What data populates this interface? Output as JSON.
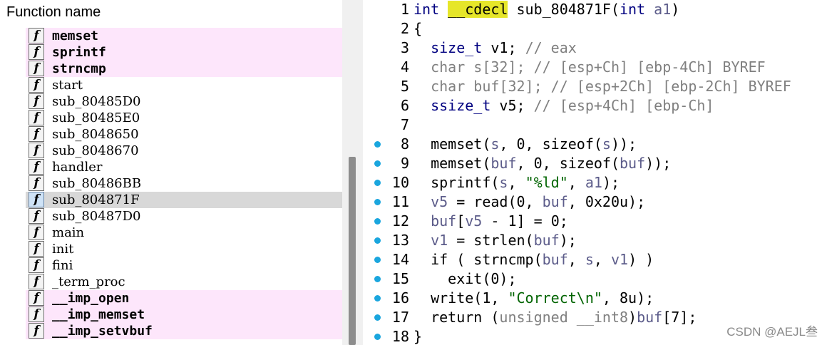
{
  "function_list": {
    "header": "Function name",
    "icon_glyph": "f",
    "items": [
      {
        "name": "memset",
        "imported": true
      },
      {
        "name": "sprintf",
        "imported": true
      },
      {
        "name": "strncmp",
        "imported": true
      },
      {
        "name": "start"
      },
      {
        "name": "sub_80485D0"
      },
      {
        "name": "sub_80485E0"
      },
      {
        "name": "sub_8048650"
      },
      {
        "name": "sub_8048670"
      },
      {
        "name": "handler"
      },
      {
        "name": "sub_80486BB"
      },
      {
        "name": "sub_804871F",
        "selected": true
      },
      {
        "name": "sub_80487D0"
      },
      {
        "name": "main"
      },
      {
        "name": "init"
      },
      {
        "name": "fini"
      },
      {
        "name": "_term_proc"
      },
      {
        "name": "__imp_open",
        "imported": true
      },
      {
        "name": "__imp_memset",
        "imported": true
      },
      {
        "name": "__imp_setvbuf",
        "imported": true
      }
    ]
  },
  "code": {
    "lines": [
      {
        "n": "1",
        "bp": false,
        "tokens": [
          [
            "kw",
            "int"
          ],
          [
            "id",
            " "
          ],
          [
            "hl",
            "__cdecl"
          ],
          [
            "id",
            " sub_804871F("
          ],
          [
            "kw",
            "int"
          ],
          [
            "var",
            " a1"
          ],
          [
            "id",
            ")"
          ]
        ]
      },
      {
        "n": "2",
        "bp": false,
        "tokens": [
          [
            "id",
            "{"
          ]
        ]
      },
      {
        "n": "3",
        "bp": false,
        "tokens": [
          [
            "id",
            "  "
          ],
          [
            "kw",
            "size_t"
          ],
          [
            "id",
            " v1; "
          ],
          [
            "cmt",
            "// eax"
          ]
        ]
      },
      {
        "n": "4",
        "bp": false,
        "tokens": [
          [
            "dim",
            "  char s[32]; "
          ],
          [
            "cmt",
            "// [esp+Ch] [ebp-4Ch] BYREF"
          ]
        ]
      },
      {
        "n": "5",
        "bp": false,
        "tokens": [
          [
            "dim",
            "  char buf[32]; "
          ],
          [
            "cmt",
            "// [esp+2Ch] [ebp-2Ch] BYREF"
          ]
        ]
      },
      {
        "n": "6",
        "bp": false,
        "tokens": [
          [
            "id",
            "  "
          ],
          [
            "kw",
            "ssize_t"
          ],
          [
            "id",
            " v5; "
          ],
          [
            "cmt",
            "// [esp+4Ch] [ebp-Ch]"
          ]
        ]
      },
      {
        "n": "7",
        "bp": false,
        "tokens": []
      },
      {
        "n": "8",
        "bp": true,
        "tokens": [
          [
            "id",
            "  memset("
          ],
          [
            "var",
            "s"
          ],
          [
            "id",
            ", 0, sizeof("
          ],
          [
            "var",
            "s"
          ],
          [
            "id",
            "));"
          ]
        ]
      },
      {
        "n": "9",
        "bp": true,
        "tokens": [
          [
            "id",
            "  memset("
          ],
          [
            "var",
            "buf"
          ],
          [
            "id",
            ", 0, sizeof("
          ],
          [
            "var",
            "buf"
          ],
          [
            "id",
            "));"
          ]
        ]
      },
      {
        "n": "10",
        "bp": true,
        "tokens": [
          [
            "id",
            "  sprintf("
          ],
          [
            "var",
            "s"
          ],
          [
            "id",
            ", "
          ],
          [
            "str",
            "\"%ld\""
          ],
          [
            "id",
            ", "
          ],
          [
            "var",
            "a1"
          ],
          [
            "id",
            ");"
          ]
        ]
      },
      {
        "n": "11",
        "bp": true,
        "tokens": [
          [
            "id",
            "  "
          ],
          [
            "var",
            "v5"
          ],
          [
            "id",
            " = read(0, "
          ],
          [
            "var",
            "buf"
          ],
          [
            "id",
            ", 0x20u);"
          ]
        ]
      },
      {
        "n": "12",
        "bp": true,
        "tokens": [
          [
            "id",
            "  "
          ],
          [
            "var",
            "buf"
          ],
          [
            "id",
            "["
          ],
          [
            "var",
            "v5"
          ],
          [
            "id",
            " - 1] = 0;"
          ]
        ]
      },
      {
        "n": "13",
        "bp": true,
        "tokens": [
          [
            "id",
            "  "
          ],
          [
            "var",
            "v1"
          ],
          [
            "id",
            " = strlen("
          ],
          [
            "var",
            "buf"
          ],
          [
            "id",
            ");"
          ]
        ]
      },
      {
        "n": "14",
        "bp": true,
        "tokens": [
          [
            "id",
            "  if ( strncmp("
          ],
          [
            "var",
            "buf"
          ],
          [
            "id",
            ", "
          ],
          [
            "var",
            "s"
          ],
          [
            "id",
            ", "
          ],
          [
            "var",
            "v1"
          ],
          [
            "id",
            ") )"
          ]
        ]
      },
      {
        "n": "15",
        "bp": true,
        "tokens": [
          [
            "id",
            "    exit(0);"
          ]
        ]
      },
      {
        "n": "16",
        "bp": true,
        "tokens": [
          [
            "id",
            "  write(1, "
          ],
          [
            "str",
            "\"Correct\\n\""
          ],
          [
            "id",
            ", 8u);"
          ]
        ]
      },
      {
        "n": "17",
        "bp": true,
        "tokens": [
          [
            "id",
            "  return ("
          ],
          [
            "dim",
            "unsigned __int8"
          ],
          [
            "id",
            ")"
          ],
          [
            "var",
            "buf"
          ],
          [
            "id",
            "[7];"
          ]
        ]
      },
      {
        "n": "18",
        "bp": true,
        "tokens": [
          [
            "id",
            "}"
          ]
        ]
      }
    ]
  },
  "watermark": "CSDN @AEJL叁"
}
